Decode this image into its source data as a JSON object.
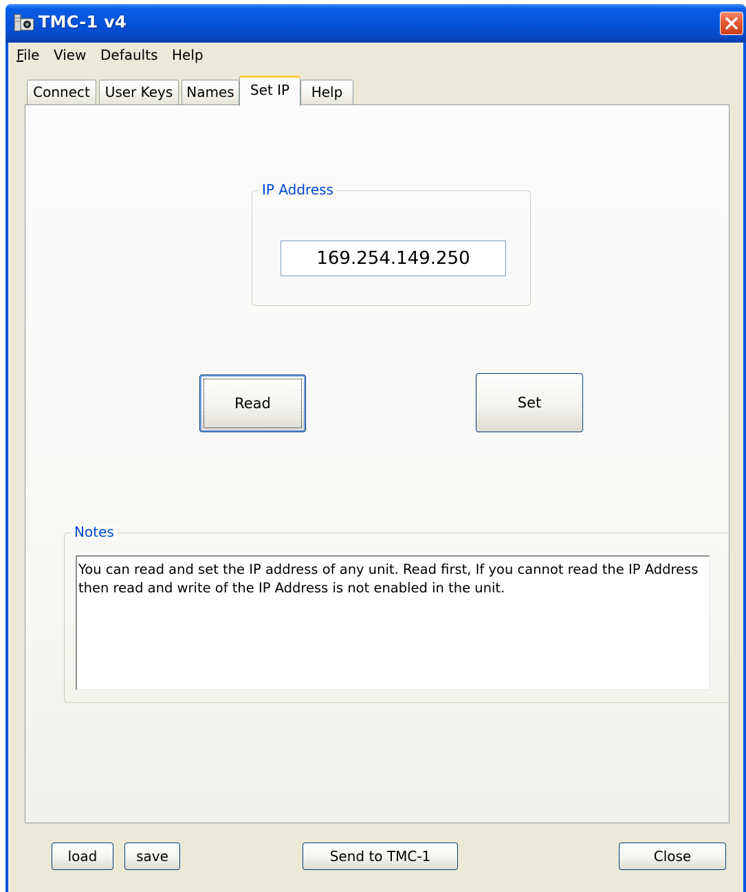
{
  "window": {
    "title": "TMC-1 v4"
  },
  "menu": [
    {
      "mnemonic": "F",
      "rest": "ile"
    },
    {
      "mnemonic": "",
      "rest": "View"
    },
    {
      "mnemonic": "",
      "rest": "Defaults"
    },
    {
      "mnemonic": "",
      "rest": "Help"
    }
  ],
  "tabs": [
    "Connect",
    "User Keys",
    "Names",
    "Set IP",
    "Help"
  ],
  "active_tab": "Set IP",
  "ip_group": {
    "label": "IP Address",
    "value": "169.254.149.250"
  },
  "actions": {
    "read_label": "Read",
    "set_label": "Set"
  },
  "notes": {
    "label": "Notes",
    "text": "You can read and set the IP address of any unit. Read first, If you cannot read the IP Address then read and write of the IP Address is not enabled in the unit."
  },
  "footer": {
    "load_label": "load",
    "save_label": "save",
    "send_label": "Send to TMC-1",
    "close_label": "Close"
  },
  "colors": {
    "titlebar": "#0552d8",
    "group_label": "#0046d5",
    "dialog_bg": "#ece9d8",
    "active_tab_highlight": "#ffc83c",
    "close_button": "#e35a36"
  },
  "icons": {
    "app": "camera-icon",
    "close": "close-x-icon"
  }
}
